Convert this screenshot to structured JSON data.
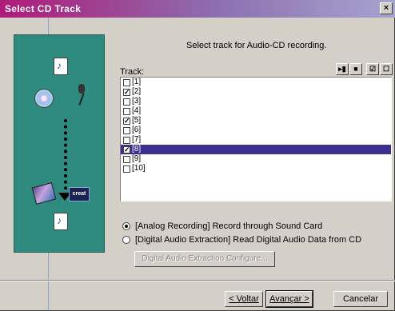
{
  "window": {
    "title": "Select CD Track",
    "close_glyph": "×"
  },
  "instruction": "Select track for Audio-CD recording.",
  "track_label": "Track:",
  "track_tools": [
    {
      "name": "play-pause-icon",
      "glyph": "▸▮"
    },
    {
      "name": "stop-icon",
      "glyph": "■"
    },
    {
      "name": "select-all-icon",
      "glyph": "☑"
    },
    {
      "name": "deselect-all-icon",
      "glyph": "☐"
    }
  ],
  "tracks": [
    {
      "label": "[1]",
      "checked": false,
      "selected": false
    },
    {
      "label": "[2]",
      "checked": true,
      "selected": false
    },
    {
      "label": "[3]",
      "checked": false,
      "selected": false
    },
    {
      "label": "[4]",
      "checked": false,
      "selected": false
    },
    {
      "label": "[5]",
      "checked": true,
      "selected": false
    },
    {
      "label": "[6]",
      "checked": false,
      "selected": false
    },
    {
      "label": "[7]",
      "checked": false,
      "selected": false
    },
    {
      "label": "[8]",
      "checked": true,
      "selected": true
    },
    {
      "label": "[9]",
      "checked": false,
      "selected": false
    },
    {
      "label": "[10]",
      "checked": false,
      "selected": false
    }
  ],
  "options": {
    "analog": {
      "label": "[Analog Recording] Record through Sound Card",
      "selected": true
    },
    "digital": {
      "label": "[Digital Audio Extraction] Read Digital Audio Data from CD",
      "selected": false
    }
  },
  "configure_button": "Digital Audio Extraction Configure...",
  "buttons": {
    "back": "< Voltar",
    "next": "Avançar >",
    "cancel": "Cancelar"
  },
  "art_card_text": "creat",
  "colors": {
    "title_start": "#b01a78",
    "title_end": "#a7a3cf",
    "art_bg": "#2f8a80",
    "selection": "#3b2f8f"
  }
}
